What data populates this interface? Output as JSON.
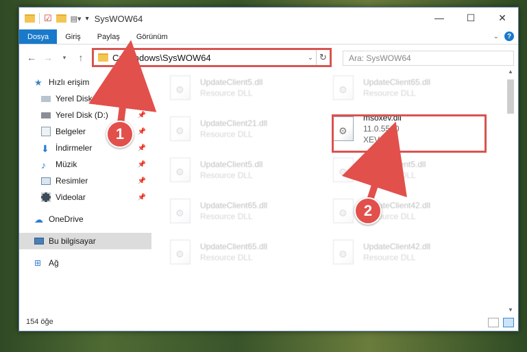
{
  "window": {
    "title": "SysWOW64",
    "controls": {
      "minimize": "—",
      "maximize": "☐",
      "close": "✕"
    }
  },
  "ribbon": {
    "tabs": [
      "Dosya",
      "Giriş",
      "Paylaş",
      "Görünüm"
    ]
  },
  "address_bar": {
    "path": "C:\\Windows\\SysWOW64",
    "search_placeholder": "Ara: SysWOW64"
  },
  "sidebar": {
    "quick_access": "Hızlı erişim",
    "items": [
      {
        "label": "Yerel Disk (C:)",
        "icon": "drive-icon",
        "pinned": true
      },
      {
        "label": "Yerel Disk (D:)",
        "icon": "drive-icon",
        "pinned": true
      },
      {
        "label": "Belgeler",
        "icon": "documents-icon",
        "pinned": true
      },
      {
        "label": "İndirmeler",
        "icon": "download-icon",
        "pinned": true
      },
      {
        "label": "Müzik",
        "icon": "music-icon",
        "pinned": true
      },
      {
        "label": "Resimler",
        "icon": "pictures-icon",
        "pinned": true
      },
      {
        "label": "Videolar",
        "icon": "videos-icon",
        "pinned": true
      }
    ],
    "onedrive": "OneDrive",
    "this_pc": "Bu bilgisayar",
    "network": "Ağ"
  },
  "files": [
    {
      "name": "UpdateClient5.dll",
      "desc": "Resource DLL",
      "col": 0,
      "row": 0
    },
    {
      "name": "UpdateClient65.dll",
      "desc": "Resource DLL",
      "col": 1,
      "row": 0
    },
    {
      "name": "UpdateClient21.dll",
      "desc": "Resource DLL",
      "col": 0,
      "row": 1
    },
    {
      "name": "msoxev.dll",
      "desc": "11.0.5510",
      "desc2": "XEV",
      "col": 1,
      "row": 1,
      "highlight": true
    },
    {
      "name": "UpdateClient5.dll",
      "desc": "Resource DLL",
      "col": 0,
      "row": 2
    },
    {
      "name": "UpdateClient5.dll",
      "desc": "Resource DLL",
      "col": 1,
      "row": 2
    },
    {
      "name": "UpdateClient65.dll",
      "desc": "Resource DLL",
      "col": 0,
      "row": 3
    },
    {
      "name": "UpdateClient42.dll",
      "desc": "Resource DLL",
      "col": 1,
      "row": 3
    },
    {
      "name": "UpdateClient65.dll",
      "desc": "Resource DLL",
      "col": 0,
      "row": 4
    },
    {
      "name": "UpdateClient42.dll",
      "desc": "Resource DLL",
      "col": 1,
      "row": 4
    }
  ],
  "status": {
    "count": "154 öğe"
  },
  "annotations": {
    "marker1": "1",
    "marker2": "2",
    "color": "#e2504c"
  }
}
